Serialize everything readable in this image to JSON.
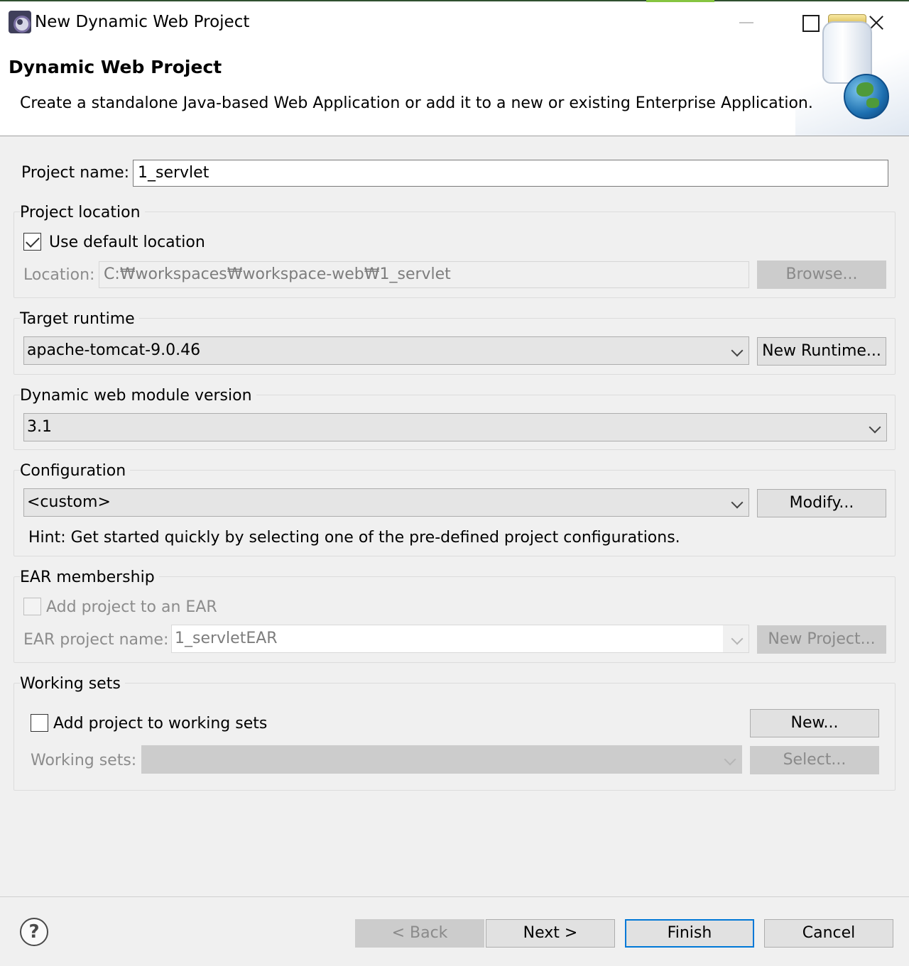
{
  "window": {
    "title": "New Dynamic Web Project"
  },
  "header": {
    "title": "Dynamic Web Project",
    "description": "Create a standalone Java-based Web Application or add it to a new or existing Enterprise Application."
  },
  "project_name": {
    "label": "Project name:",
    "value": "1_servlet"
  },
  "project_location": {
    "group_title": "Project location",
    "use_default_label": "Use default location",
    "use_default_checked": true,
    "location_label": "Location:",
    "location_value": "C:₩workspaces₩workspace-web₩1_servlet",
    "browse_label": "Browse..."
  },
  "target_runtime": {
    "group_title": "Target runtime",
    "selected": "apache-tomcat-9.0.46",
    "new_runtime_label": "New Runtime..."
  },
  "module_version": {
    "group_title": "Dynamic web module version",
    "selected": "3.1"
  },
  "configuration": {
    "group_title": "Configuration",
    "selected": "<custom>",
    "modify_label": "Modify...",
    "hint": "Hint: Get started quickly by selecting one of the pre-defined project configurations."
  },
  "ear_membership": {
    "group_title": "EAR membership",
    "add_label": "Add project to an EAR",
    "add_checked": false,
    "ear_name_label": "EAR project name:",
    "ear_name_value": "1_servletEAR",
    "new_project_label": "New Project..."
  },
  "working_sets": {
    "group_title": "Working sets",
    "add_label": "Add project to working sets",
    "add_checked": false,
    "new_label": "New...",
    "sets_label": "Working sets:",
    "sets_value": "",
    "select_label": "Select..."
  },
  "footer": {
    "help_glyph": "?",
    "back_label": "< Back",
    "next_label": "Next >",
    "finish_label": "Finish",
    "cancel_label": "Cancel"
  }
}
